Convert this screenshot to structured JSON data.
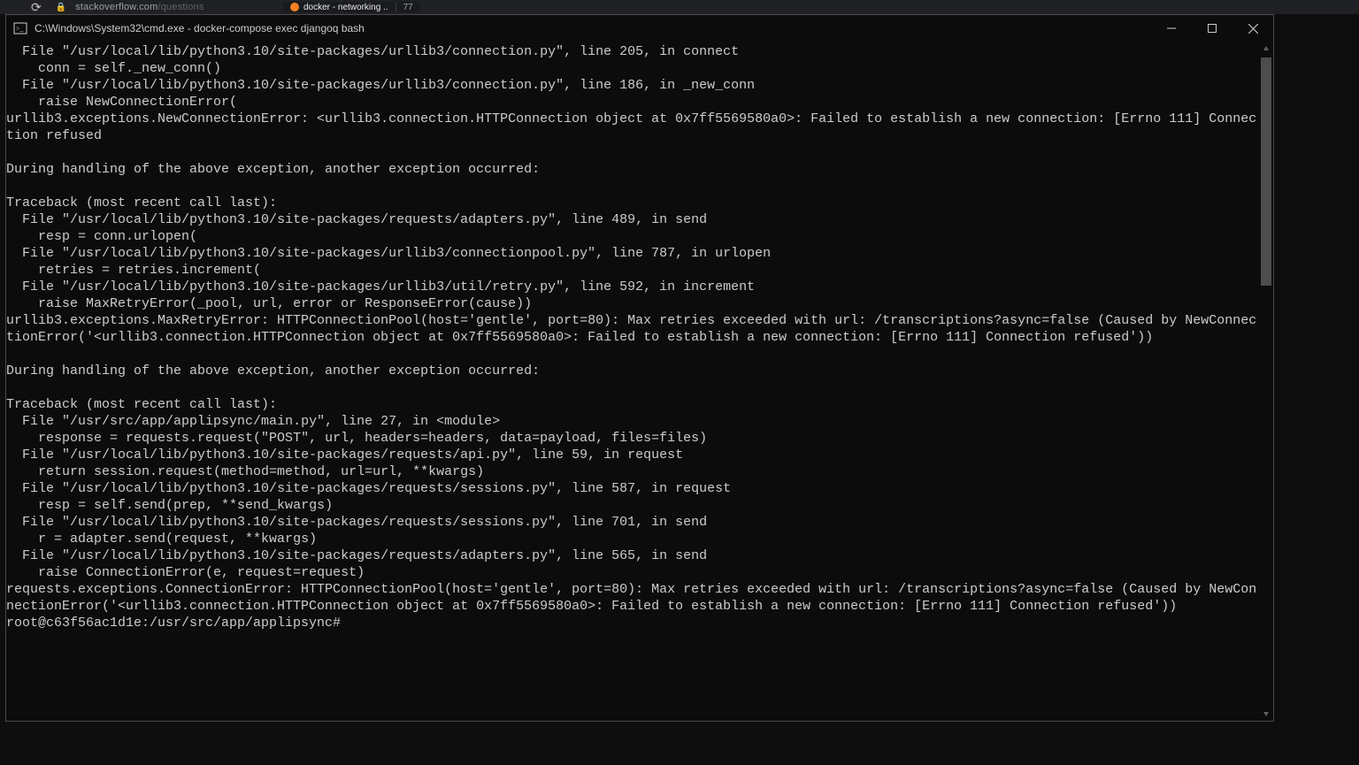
{
  "browser": {
    "url_host": "stackoverflow.com",
    "url_path": "/questions",
    "tab_a": "docker - networking ..",
    "tab_b": "77"
  },
  "window": {
    "title": "C:\\Windows\\System32\\cmd.exe - docker-compose  exec djangoq bash"
  },
  "terminal": {
    "lines": [
      "  File \"/usr/local/lib/python3.10/site-packages/urllib3/connection.py\", line 205, in connect",
      "    conn = self._new_conn()",
      "  File \"/usr/local/lib/python3.10/site-packages/urllib3/connection.py\", line 186, in _new_conn",
      "    raise NewConnectionError(",
      "urllib3.exceptions.NewConnectionError: <urllib3.connection.HTTPConnection object at 0x7ff5569580a0>: Failed to establish a new connection: [Errno 111] Connection refused",
      "",
      "During handling of the above exception, another exception occurred:",
      "",
      "Traceback (most recent call last):",
      "  File \"/usr/local/lib/python3.10/site-packages/requests/adapters.py\", line 489, in send",
      "    resp = conn.urlopen(",
      "  File \"/usr/local/lib/python3.10/site-packages/urllib3/connectionpool.py\", line 787, in urlopen",
      "    retries = retries.increment(",
      "  File \"/usr/local/lib/python3.10/site-packages/urllib3/util/retry.py\", line 592, in increment",
      "    raise MaxRetryError(_pool, url, error or ResponseError(cause))",
      "urllib3.exceptions.MaxRetryError: HTTPConnectionPool(host='gentle', port=80): Max retries exceeded with url: /transcriptions?async=false (Caused by NewConnectionError('<urllib3.connection.HTTPConnection object at 0x7ff5569580a0>: Failed to establish a new connection: [Errno 111] Connection refused'))",
      "",
      "During handling of the above exception, another exception occurred:",
      "",
      "Traceback (most recent call last):",
      "  File \"/usr/src/app/applipsync/main.py\", line 27, in <module>",
      "    response = requests.request(\"POST\", url, headers=headers, data=payload, files=files)",
      "  File \"/usr/local/lib/python3.10/site-packages/requests/api.py\", line 59, in request",
      "    return session.request(method=method, url=url, **kwargs)",
      "  File \"/usr/local/lib/python3.10/site-packages/requests/sessions.py\", line 587, in request",
      "    resp = self.send(prep, **send_kwargs)",
      "  File \"/usr/local/lib/python3.10/site-packages/requests/sessions.py\", line 701, in send",
      "    r = adapter.send(request, **kwargs)",
      "  File \"/usr/local/lib/python3.10/site-packages/requests/adapters.py\", line 565, in send",
      "    raise ConnectionError(e, request=request)",
      "requests.exceptions.ConnectionError: HTTPConnectionPool(host='gentle', port=80): Max retries exceeded with url: /transcriptions?async=false (Caused by NewConnectionError('<urllib3.connection.HTTPConnection object at 0x7ff5569580a0>: Failed to establish a new connection: [Errno 111] Connection refused'))"
    ],
    "prompt": "root@c63f56ac1d1e:/usr/src/app/applipsync#"
  }
}
